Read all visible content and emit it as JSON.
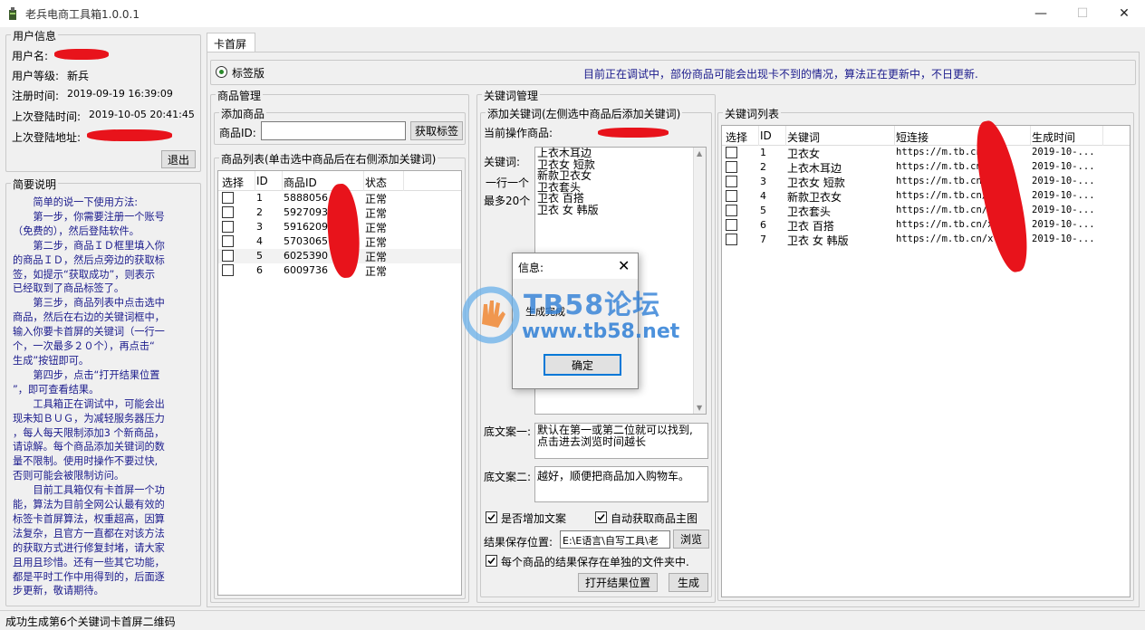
{
  "window": {
    "title": "老兵电商工具箱1.0.0.1",
    "minimize": "—",
    "maximize": "☐",
    "close": "✕"
  },
  "user_info": {
    "group_label": "用户信息",
    "username_label": "用户名:",
    "level_label": "用户等级:",
    "level_value": "新兵",
    "register_label": "注册时间:",
    "register_value": "2019-09-19  16:39:09",
    "last_login_label": "上次登陆时间:",
    "last_login_value": "2019-10-05  20:41:45",
    "last_addr_label": "上次登陆地址:",
    "logout_label": "退出"
  },
  "intro": {
    "group_label": "简要说明",
    "lines": [
      "　　简单的说一下使用方法:",
      "　　第一步，你需要注册一个账号",
      "（免费的），然后登陆软件。",
      "　　第二步，商品ＩＤ框里填入你",
      "的商品ＩＤ，然后点旁边的获取标",
      "签，如提示“获取成功”，则表示",
      "已经取到了商品标签了。",
      "　　第三步，商品列表中点击选中",
      "商品，然后在右边的关键词框中，",
      "输入你要卡首屏的关键词（一行一",
      "个，一次最多２０个），再点击“",
      "生成”按钮即可。",
      "　　第四步，点击“打开结果位置",
      "”，即可查看结果。",
      "　　工具箱正在调试中，可能会出",
      "现未知ＢＵＧ，为减轻服务器压力",
      "，每人每天限制添加3 个新商品，",
      "请谅解。每个商品添加关键词的数",
      "量不限制。使用时操作不要过快,",
      "否则可能会被限制访问。",
      "　　目前工具箱仅有卡首屏一个功",
      "能，算法为目前全网公认最有效的",
      "标签卡首屏算法，权重超高，因算",
      "法复杂，且官方一直都在对该方法",
      "的获取方式进行修复封堵，请大家",
      "且用且珍惜。还有一些其它功能，",
      "都是平时工作中用得到的，后面逐",
      "步更新，敬请期待。"
    ]
  },
  "tab": {
    "label": "卡首屏"
  },
  "version_bar": {
    "radio_label": "标签版",
    "notice": "目前正在调试中，部份商品可能会出现卡不到的情况，算法正在更新中，不日更新."
  },
  "product_mgmt": {
    "group_label": "商品管理",
    "add_label": "添加商品",
    "id_label": "商品ID:",
    "id_value": "",
    "get_tag_label": "获取标签",
    "list_label": "商品列表(单击选中商品后在右侧添加关键词)",
    "columns": [
      "选择",
      "ID",
      "商品ID",
      "状态"
    ],
    "rows": [
      {
        "id": "1",
        "pid": "5888056",
        "status": "正常"
      },
      {
        "id": "2",
        "pid": "5927093",
        "status": "正常"
      },
      {
        "id": "3",
        "pid": "5916209",
        "status": "正常"
      },
      {
        "id": "4",
        "pid": "5703065",
        "status": "正常"
      },
      {
        "id": "5",
        "pid": "6025390",
        "status": "正常"
      },
      {
        "id": "6",
        "pid": "6009736",
        "status": "正常"
      }
    ]
  },
  "keyword_mgmt": {
    "group_label": "关键词管理",
    "add_label": "添加关键词(左侧选中商品后添加关键词)",
    "current_label": "当前操作商品:",
    "kw_label_1": "关键词:",
    "kw_label_2": "一行一个",
    "kw_label_3": "最多20个",
    "keywords": [
      "上衣木耳边",
      "卫衣女 短款",
      "新款卫衣女",
      "卫衣套头",
      "卫衣 百搭",
      "卫衣 女 韩版"
    ],
    "bottom1_label": "底文案一:",
    "bottom1_lines": [
      "默认在第一或第二位就可以找到,",
      "点击进去浏览时间越长"
    ],
    "bottom2_label": "底文案二:",
    "bottom2_text": "越好，顺便把商品加入购物车。",
    "add_copy_label": "是否增加文案",
    "auto_img_label": "自动获取商品主图",
    "save_path_label": "结果保存位置:",
    "save_path_value": "E:\\E语言\\自写工具\\老",
    "browse_label": "浏览",
    "separate_folder_label": "每个商品的结果保存在单独的文件夹中.",
    "open_result_label": "打开结果位置",
    "generate_label": "生成"
  },
  "keyword_list": {
    "group_label": "关键词列表",
    "columns": [
      "选择",
      "ID",
      "关键词",
      "短连接",
      "生成时间"
    ],
    "rows": [
      {
        "id": "1",
        "kw": "卫衣女",
        "link": "https://m.tb.cn/x.",
        "time": "2019-10-..."
      },
      {
        "id": "2",
        "kw": "上衣木耳边",
        "link": "https://m.tb.cn/x.",
        "time": "2019-10-..."
      },
      {
        "id": "3",
        "kw": "卫衣女 短款",
        "link": "https://m.tb.cn/x.",
        "time": "2019-10-..."
      },
      {
        "id": "4",
        "kw": "新款卫衣女",
        "link": "https://m.tb.cn/x.",
        "time": "2019-10-..."
      },
      {
        "id": "5",
        "kw": "卫衣套头",
        "link": "https://m.tb.cn/x.",
        "time": "2019-10-..."
      },
      {
        "id": "6",
        "kw": "卫衣 百搭",
        "link": "https://m.tb.cn/x.",
        "time": "2019-10-..."
      },
      {
        "id": "7",
        "kw": "卫衣 女 韩版",
        "link": "https://m.tb.cn/x.",
        "time": "2019-10-..."
      }
    ]
  },
  "dialog": {
    "title": "信息:",
    "message": "生成完成",
    "ok_label": "确定"
  },
  "watermark": {
    "line1": "TB58论坛",
    "line2": "www.tb58.net"
  },
  "status_bar": {
    "text": "成功生成第6个关键词卡首屏二维码"
  },
  "colors": {
    "accent": "#0078d7",
    "redaction": "#e8131b",
    "notice_text": "#1a1a8c",
    "watermark": "#2f7fd6"
  }
}
